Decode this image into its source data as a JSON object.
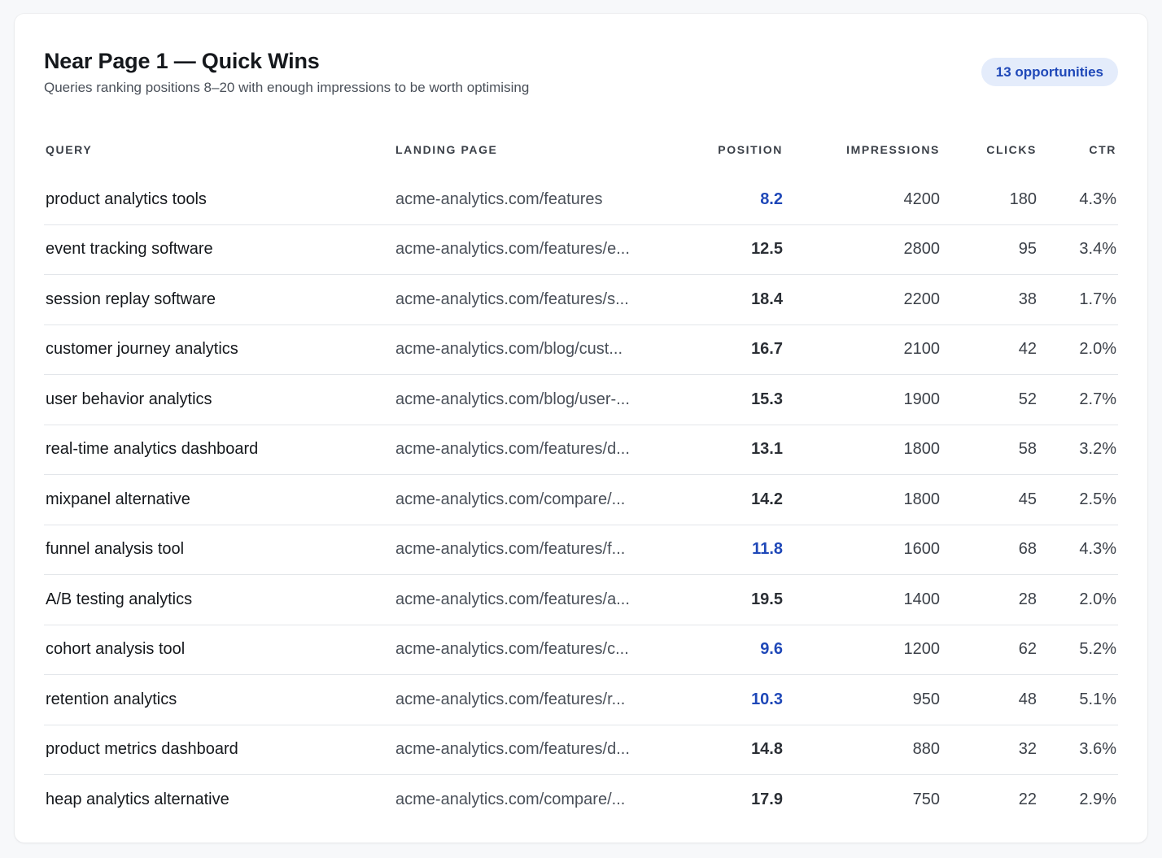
{
  "panel": {
    "title": "Near Page 1 — Quick Wins",
    "subtitle": "Queries ranking positions 8–20 with enough impressions to be worth optimising",
    "badge": "13 opportunities"
  },
  "colors": {
    "accent": "#1f48b8",
    "badge_bg": "#e4ecfb"
  },
  "table": {
    "columns": [
      "Query",
      "Landing Page",
      "Position",
      "Impressions",
      "Clicks",
      "CTR"
    ],
    "rows": [
      {
        "query": "product analytics tools",
        "page": "acme-analytics.com/features",
        "position": "8.2",
        "highlight": true,
        "impressions": "4200",
        "clicks": "180",
        "ctr": "4.3%"
      },
      {
        "query": "event tracking software",
        "page": "acme-analytics.com/features/e...",
        "position": "12.5",
        "highlight": false,
        "impressions": "2800",
        "clicks": "95",
        "ctr": "3.4%"
      },
      {
        "query": "session replay software",
        "page": "acme-analytics.com/features/s...",
        "position": "18.4",
        "highlight": false,
        "impressions": "2200",
        "clicks": "38",
        "ctr": "1.7%"
      },
      {
        "query": "customer journey analytics",
        "page": "acme-analytics.com/blog/cust...",
        "position": "16.7",
        "highlight": false,
        "impressions": "2100",
        "clicks": "42",
        "ctr": "2.0%"
      },
      {
        "query": "user behavior analytics",
        "page": "acme-analytics.com/blog/user-...",
        "position": "15.3",
        "highlight": false,
        "impressions": "1900",
        "clicks": "52",
        "ctr": "2.7%"
      },
      {
        "query": "real-time analytics dashboard",
        "page": "acme-analytics.com/features/d...",
        "position": "13.1",
        "highlight": false,
        "impressions": "1800",
        "clicks": "58",
        "ctr": "3.2%"
      },
      {
        "query": "mixpanel alternative",
        "page": "acme-analytics.com/compare/...",
        "position": "14.2",
        "highlight": false,
        "impressions": "1800",
        "clicks": "45",
        "ctr": "2.5%"
      },
      {
        "query": "funnel analysis tool",
        "page": "acme-analytics.com/features/f...",
        "position": "11.8",
        "highlight": true,
        "impressions": "1600",
        "clicks": "68",
        "ctr": "4.3%"
      },
      {
        "query": "A/B testing analytics",
        "page": "acme-analytics.com/features/a...",
        "position": "19.5",
        "highlight": false,
        "impressions": "1400",
        "clicks": "28",
        "ctr": "2.0%"
      },
      {
        "query": "cohort analysis tool",
        "page": "acme-analytics.com/features/c...",
        "position": "9.6",
        "highlight": true,
        "impressions": "1200",
        "clicks": "62",
        "ctr": "5.2%"
      },
      {
        "query": "retention analytics",
        "page": "acme-analytics.com/features/r...",
        "position": "10.3",
        "highlight": true,
        "impressions": "950",
        "clicks": "48",
        "ctr": "5.1%"
      },
      {
        "query": "product metrics dashboard",
        "page": "acme-analytics.com/features/d...",
        "position": "14.8",
        "highlight": false,
        "impressions": "880",
        "clicks": "32",
        "ctr": "3.6%"
      },
      {
        "query": "heap analytics alternative",
        "page": "acme-analytics.com/compare/...",
        "position": "17.9",
        "highlight": false,
        "impressions": "750",
        "clicks": "22",
        "ctr": "2.9%"
      }
    ]
  }
}
